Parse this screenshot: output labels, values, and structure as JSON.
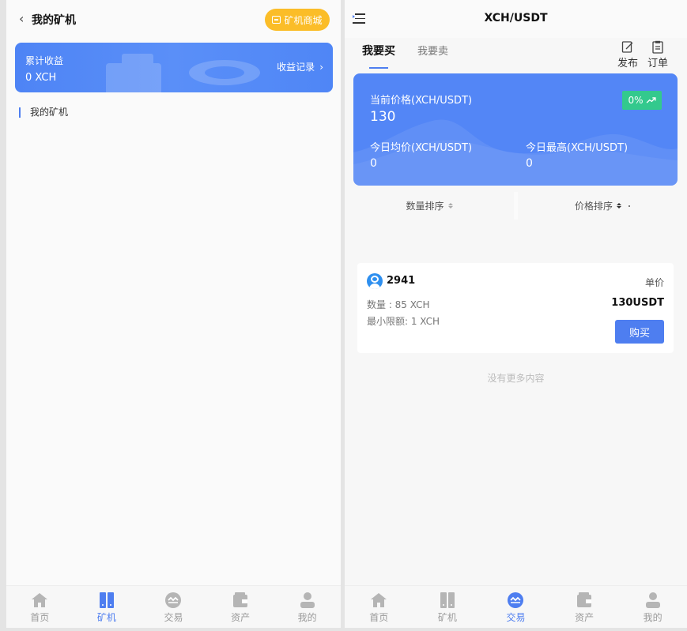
{
  "left": {
    "title": "我的矿机",
    "shop_button": "矿机商城",
    "earnings": {
      "label": "累计收益",
      "value": "0 XCH",
      "link": "收益记录"
    },
    "section_title": "我的矿机"
  },
  "right": {
    "title": "XCH/USDT",
    "tabs": {
      "buy": "我要买",
      "sell": "我要卖"
    },
    "tools": {
      "publish": "发布",
      "orders": "订单"
    },
    "price": {
      "current_label": "当前价格(XCH/USDT)",
      "current_value": "130",
      "change": "0%",
      "avg_label": "今日均价(XCH/USDT)",
      "avg_value": "0",
      "high_label": "今日最高(XCH/USDT)",
      "high_value": "0"
    },
    "sort": {
      "quantity": "数量排序",
      "price": "价格排序"
    },
    "order": {
      "seller": "2941",
      "unit_label": "单价",
      "quantity": "数量 : 85 XCH",
      "min_limit": "最小限额: 1 XCH",
      "unit_price": "130USDT",
      "buy_label": "购买"
    },
    "no_more": "没有更多内容"
  },
  "tabbar": [
    {
      "label": "首页",
      "icon": "home-icon"
    },
    {
      "label": "矿机",
      "icon": "miner-icon"
    },
    {
      "label": "交易",
      "icon": "trade-icon"
    },
    {
      "label": "资产",
      "icon": "wallet-icon"
    },
    {
      "label": "我的",
      "icon": "user-icon"
    }
  ],
  "tabbar_active": {
    "left": "矿机",
    "right": "交易"
  },
  "colors": {
    "primary": "#4e7ef0",
    "accent_yellow": "#fbbd28",
    "up_green": "#33c98d",
    "card_blue": "#5386f6"
  }
}
